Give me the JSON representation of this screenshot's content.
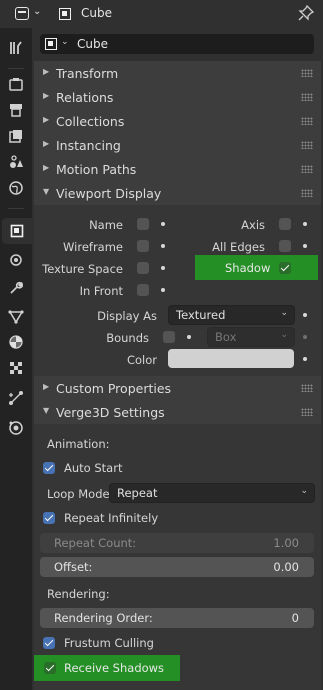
{
  "header": {
    "title": "Cube"
  },
  "object_name": "Cube",
  "panels": {
    "transform": "Transform",
    "relations": "Relations",
    "collections": "Collections",
    "instancing": "Instancing",
    "motion_paths": "Motion Paths",
    "viewport_display": "Viewport Display",
    "custom_properties": "Custom Properties",
    "verge3d_settings": "Verge3D Settings"
  },
  "viewport_display": {
    "name": {
      "label": "Name",
      "checked": false
    },
    "axis": {
      "label": "Axis",
      "checked": false
    },
    "wireframe": {
      "label": "Wireframe",
      "checked": false
    },
    "all_edges": {
      "label": "All Edges",
      "checked": false
    },
    "texture_space": {
      "label": "Texture Space",
      "checked": false
    },
    "shadow": {
      "label": "Shadow",
      "checked": true
    },
    "in_front": {
      "label": "In Front",
      "checked": false
    },
    "display_as": {
      "label": "Display As",
      "value": "Textured"
    },
    "bounds": {
      "label": "Bounds",
      "checked": false,
      "value": "Box"
    },
    "color": {
      "label": "Color",
      "value": "#d1d1d1"
    }
  },
  "verge3d": {
    "animation_label": "Animation:",
    "auto_start": {
      "label": "Auto Start",
      "checked": true
    },
    "loop_mode": {
      "label": "Loop Mode:",
      "value": "Repeat"
    },
    "repeat_infinitely": {
      "label": "Repeat Infinitely",
      "checked": true
    },
    "repeat_count": {
      "label": "Repeat Count:",
      "value": "1.00"
    },
    "offset": {
      "label": "Offset:",
      "value": "0.00"
    },
    "rendering_label": "Rendering:",
    "rendering_order": {
      "label": "Rendering Order:",
      "value": "0"
    },
    "frustum_culling": {
      "label": "Frustum Culling",
      "checked": true
    },
    "receive_shadows": {
      "label": "Receive Shadows",
      "checked": true
    }
  },
  "colors": {
    "highlight": "#248f24",
    "checkbox_on": "#4772b3"
  },
  "sidebar_tabs": [
    "tool-icon",
    "render-icon",
    "output-icon",
    "view-layer-icon",
    "scene-icon",
    "world-icon",
    "object-icon",
    "modifiers-icon",
    "particles-icon",
    "physics-icon",
    "constraints-icon",
    "data-icon",
    "material-icon",
    "texture-icon",
    "verge3d-icon"
  ]
}
